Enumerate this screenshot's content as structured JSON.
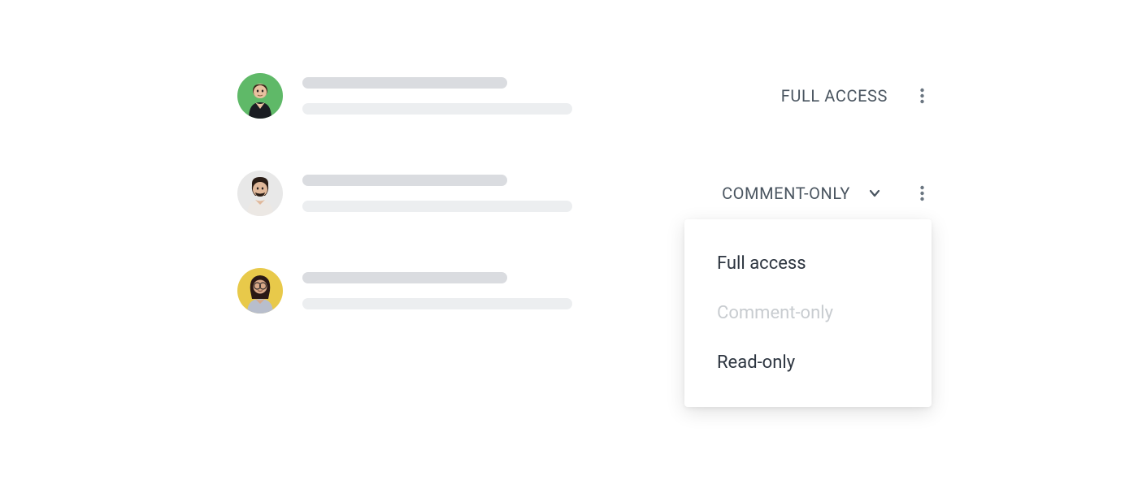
{
  "users": [
    {
      "avatar_bg": "#5fb968",
      "permission_label": "FULL ACCESS",
      "has_dropdown": false
    },
    {
      "avatar_bg": "#e8e8e8",
      "permission_label": "COMMENT-ONLY",
      "has_dropdown": true
    },
    {
      "avatar_bg": "#e8c94a",
      "permission_label": "",
      "has_dropdown": false
    }
  ],
  "dropdown": {
    "options": [
      {
        "label": "Full access",
        "selected": false
      },
      {
        "label": "Comment-only",
        "selected": true
      },
      {
        "label": "Read-only",
        "selected": false
      }
    ]
  }
}
